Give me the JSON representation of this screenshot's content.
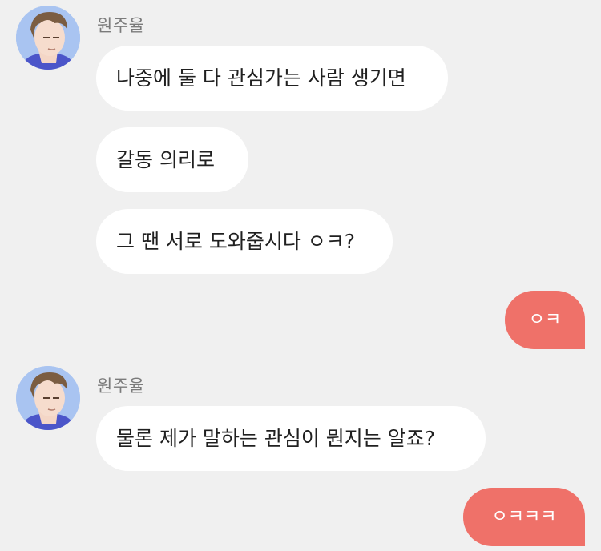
{
  "colors": {
    "background": "#f0f0f0",
    "incoming_bubble": "#ffffff",
    "outgoing_bubble": "#ef7169",
    "sender_name": "#7b7b7b"
  },
  "messages": [
    {
      "sender": "원주율",
      "texts": [
        "나중에 둘 다 관심가는 사람 생기면",
        "갈동 의리로",
        "그 땐 서로 도와줍시다 ㅇㅋ?"
      ]
    },
    {
      "mine": "ㅇㅋ"
    },
    {
      "sender": "원주율",
      "texts": [
        "물론 제가 말하는 관심이 뭔지는 알죠?"
      ]
    },
    {
      "mine": "ㅇㅋㅋㅋ"
    }
  ]
}
